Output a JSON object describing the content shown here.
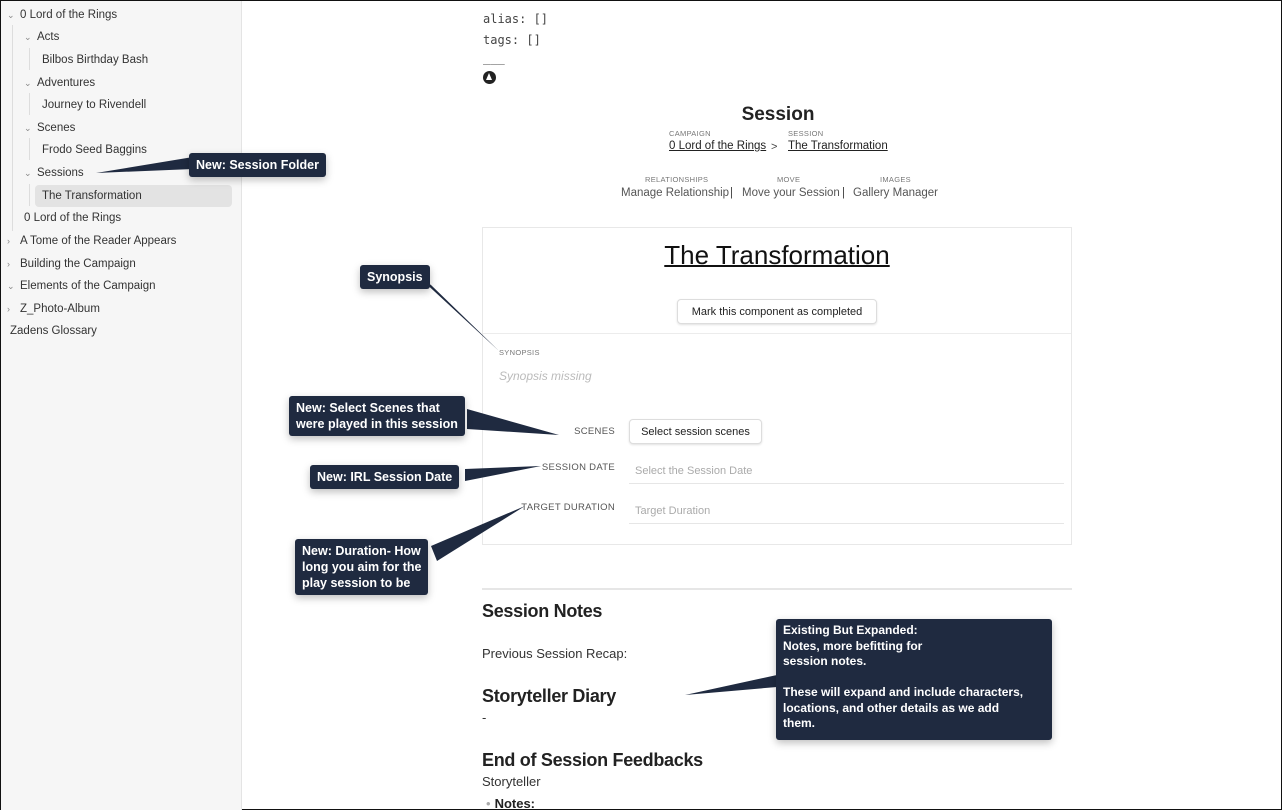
{
  "sidebar": {
    "items": [
      {
        "label": "0 Lord of the Rings",
        "chevron": "down"
      },
      {
        "label": "Acts",
        "chevron": "down"
      },
      {
        "label": "Bilbos Birthday Bash"
      },
      {
        "label": "Adventures",
        "chevron": "down"
      },
      {
        "label": "Journey to Rivendell"
      },
      {
        "label": "Scenes",
        "chevron": "down"
      },
      {
        "label": "Frodo Seed Baggins"
      },
      {
        "label": "Sessions",
        "chevron": "down"
      },
      {
        "label": "The Transformation",
        "selected": true
      },
      {
        "label": "0 Lord of the Rings"
      },
      {
        "label": "A Tome of the Reader Appears",
        "chevron": "right"
      },
      {
        "label": "Building the Campaign",
        "chevron": "right"
      },
      {
        "label": "Elements of the Campaign",
        "chevron": "down"
      },
      {
        "label": "Z_Photo-Album",
        "chevron": "right"
      },
      {
        "label": "Zadens Glossary"
      }
    ]
  },
  "frontmatter": {
    "alias": "alias: []",
    "tags": "tags: []",
    "rule": "___",
    "icon": "d20-icon"
  },
  "header": {
    "title": "Session",
    "breadcrumb": {
      "campaign_label": "Campaign",
      "campaign_link": "0 Lord of the Rings",
      "separator": ">",
      "session_label": "Session",
      "session_link": "The Transformation"
    },
    "nav": {
      "relationships_label": "Relationships",
      "relationships_link": "Manage Relationship",
      "move_label": "Move",
      "move_link": "Move your Session",
      "images_label": "Images",
      "images_link": "Gallery Manager",
      "separator": "|"
    }
  },
  "card": {
    "title": "The Transformation",
    "complete_button": "Mark this component as completed",
    "synopsis_label": "Synopsis",
    "synopsis_text": "Synopsis missing",
    "scenes_label": "Scenes",
    "scenes_button": "Select session scenes",
    "session_date_label": "Session Date",
    "session_date_placeholder": "Select the Session Date",
    "target_duration_label": "Target Duration",
    "target_duration_placeholder": "Target Duration"
  },
  "notes": {
    "session_notes_heading": "Session Notes",
    "previous_recap": "Previous Session Recap:",
    "storyteller_diary_heading": "Storyteller Diary",
    "storyteller_diary_text": "-",
    "feedbacks_heading": "End of Session Feedbacks",
    "storyteller": "Storyteller",
    "notes_bullet": "Notes:"
  },
  "callouts": {
    "session_folder": "New: Session Folder",
    "synopsis": "Synopsis",
    "select_scenes": "New: Select Scenes that\nwere played in this session",
    "irl_date": "New: IRL Session Date",
    "duration": "New: Duration- How\nlong you aim for the\nplay session to be",
    "expanded": "Existing But Expanded:\nNotes, more befitting for\nsession notes.\n\nThese will expand and include characters,\nlocations, and other details as we add\nthem."
  }
}
